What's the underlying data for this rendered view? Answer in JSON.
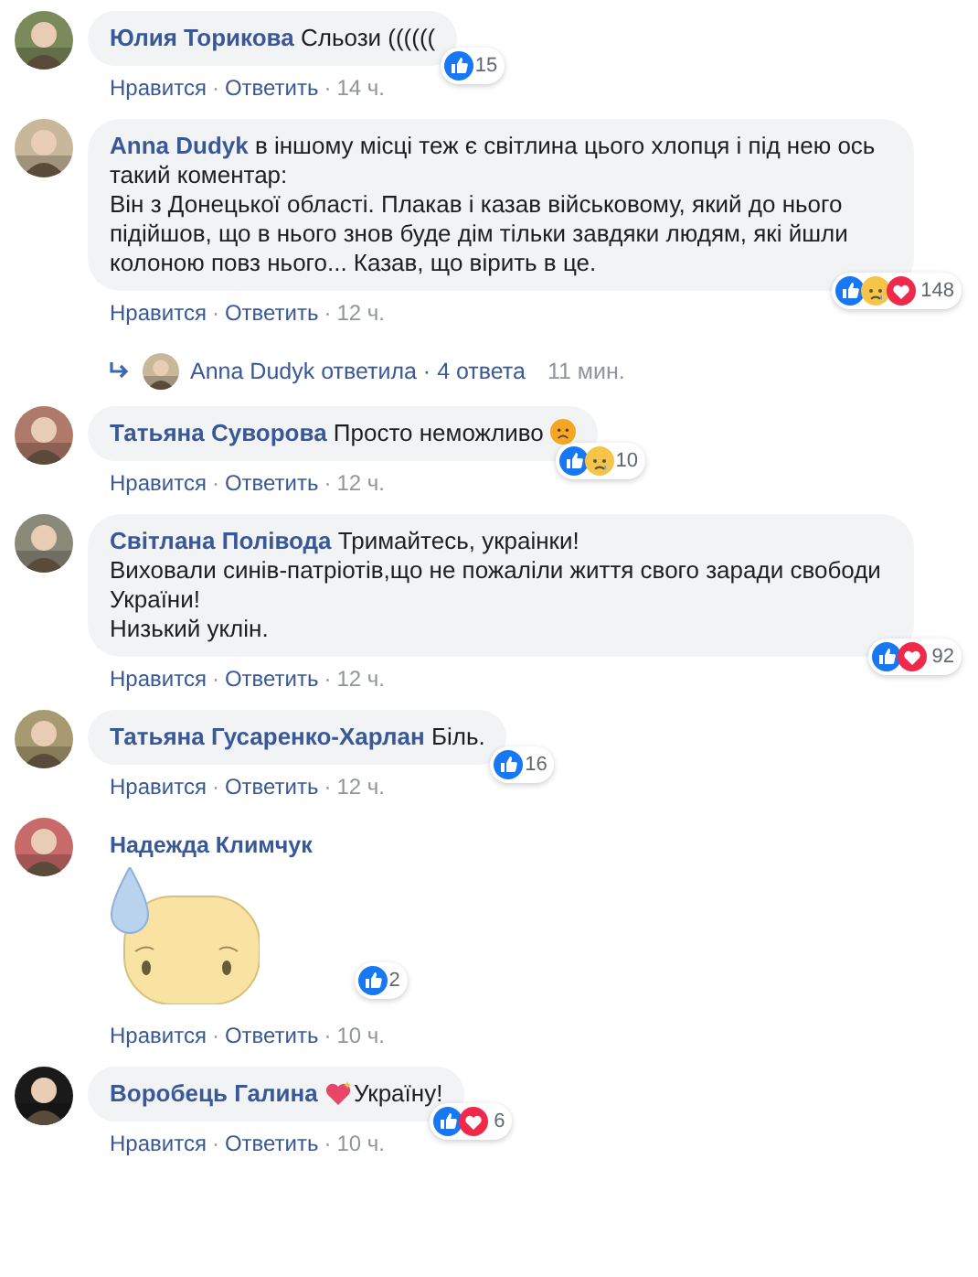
{
  "comments": [
    {
      "author": "Юлия Торикова",
      "body": [
        {
          "kind": "text",
          "text": "Сльози (((((("
        }
      ],
      "reactions": [
        {
          "kind": "like"
        }
      ],
      "count": "15",
      "footer": [
        {
          "kind": "link",
          "text": "Нравится"
        },
        {
          "kind": "dot",
          "text": "·"
        },
        {
          "kind": "link",
          "text": "Ответить"
        },
        {
          "kind": "dot",
          "text": "·"
        },
        {
          "kind": "time",
          "text": "14 ч."
        }
      ]
    },
    {
      "author": "Anna Dudyk",
      "body": [
        {
          "kind": "text",
          "text": "в іншому місці теж є світлина цього хлопця і під нею ось такий коментар:\nВін з Донецької області. Плакав і казав військовому, який до нього підійшов, що в нього знов буде дім тільки завдяки людям, які йшли колоною повз нього... Казав, що вірить в це."
        }
      ],
      "reactions": [
        {
          "kind": "like"
        },
        {
          "kind": "sad"
        },
        {
          "kind": "love"
        }
      ],
      "count": "148",
      "footer": [
        {
          "kind": "link",
          "text": "Нравится"
        },
        {
          "kind": "dot",
          "text": "·"
        },
        {
          "kind": "link",
          "text": "Ответить"
        },
        {
          "kind": "dot",
          "text": "·"
        },
        {
          "kind": "time",
          "text": "12 ч."
        }
      ],
      "replies": {
        "text": "Anna Dudyk ответила · 4 ответа",
        "time": "11 мин."
      }
    },
    {
      "author": "Татьяна Суворова",
      "body": [
        {
          "kind": "text",
          "text": "Просто неможливо "
        },
        {
          "kind": "sad-emoji"
        }
      ],
      "reactions": [
        {
          "kind": "like"
        },
        {
          "kind": "sad"
        }
      ],
      "count": "10",
      "footer": [
        {
          "kind": "link",
          "text": "Нравится"
        },
        {
          "kind": "dot",
          "text": "·"
        },
        {
          "kind": "link",
          "text": "Ответить"
        },
        {
          "kind": "dot",
          "text": "·"
        },
        {
          "kind": "time",
          "text": "12 ч."
        }
      ]
    },
    {
      "author": "Світлана Полівода",
      "body": [
        {
          "kind": "text",
          "text": "Тримайтесь, украінки!\nВиховали синів-патріотів,що не пожаліли життя свого заради свободи України!\nНизький уклін."
        }
      ],
      "reactions": [
        {
          "kind": "like"
        },
        {
          "kind": "love"
        }
      ],
      "count": "92",
      "footer": [
        {
          "kind": "link",
          "text": "Нравится"
        },
        {
          "kind": "dot",
          "text": "·"
        },
        {
          "kind": "link",
          "text": "Ответить"
        },
        {
          "kind": "dot",
          "text": "·"
        },
        {
          "kind": "time",
          "text": "12 ч."
        }
      ]
    },
    {
      "author": "Татьяна Гусаренко-Харлан",
      "body": [
        {
          "kind": "text",
          "text": "Біль."
        }
      ],
      "reactions": [
        {
          "kind": "like"
        }
      ],
      "count": "16",
      "footer": [
        {
          "kind": "link",
          "text": "Нравится"
        },
        {
          "kind": "dot",
          "text": "·"
        },
        {
          "kind": "link",
          "text": "Ответить"
        },
        {
          "kind": "dot",
          "text": "·"
        },
        {
          "kind": "time",
          "text": "12 ч."
        }
      ]
    },
    {
      "author": "Надежда Климчук",
      "body": [
        {
          "kind": "sticker"
        }
      ],
      "reactions": [
        {
          "kind": "like"
        }
      ],
      "count": "2",
      "footer": [
        {
          "kind": "link",
          "text": "Нравится"
        },
        {
          "kind": "dot",
          "text": "·"
        },
        {
          "kind": "link",
          "text": "Ответить"
        },
        {
          "kind": "dot",
          "text": "·"
        },
        {
          "kind": "time",
          "text": "10 ч."
        }
      ]
    },
    {
      "author": "Воробець Галина",
      "body": [
        {
          "kind": "heart-emoji"
        },
        {
          "kind": "text",
          "text": "Україну!"
        }
      ],
      "reactions": [
        {
          "kind": "like"
        },
        {
          "kind": "love"
        }
      ],
      "count": "6",
      "footer": [
        {
          "kind": "link",
          "text": "Нравится"
        },
        {
          "kind": "dot",
          "text": "·"
        },
        {
          "kind": "link",
          "text": "Ответить"
        },
        {
          "kind": "dot",
          "text": "·"
        },
        {
          "kind": "time",
          "text": "10 ч."
        }
      ]
    }
  ]
}
